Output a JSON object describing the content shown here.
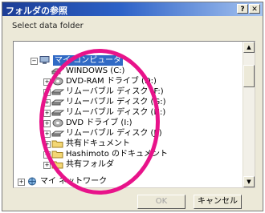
{
  "dialog": {
    "title": "フォルダの参照",
    "help_label": "?",
    "close_label": "✕",
    "prompt": "Select data folder",
    "ok_label": "OK",
    "cancel_label": "キャンセル"
  },
  "tree": {
    "root": {
      "label": "マイ コンピュータ",
      "expander": "−",
      "icon": "computer-icon"
    },
    "items": [
      {
        "label": "WINDOWS (C:)",
        "expander": "",
        "icon": "hard-drive-icon"
      },
      {
        "label": "DVD-RAM ドライブ (D:)",
        "expander": "+",
        "icon": "dvd-drive-icon"
      },
      {
        "label": "リムーバブル ディスク (F:)",
        "expander": "+",
        "icon": "removable-disk-icon"
      },
      {
        "label": "リムーバブル ディスク (G:)",
        "expander": "+",
        "icon": "removable-disk-icon"
      },
      {
        "label": "リムーバブル ディスク (H:)",
        "expander": "+",
        "icon": "removable-disk-icon"
      },
      {
        "label": "DVD ドライブ (I:)",
        "expander": "+",
        "icon": "dvd-drive-icon"
      },
      {
        "label": "リムーバブル ディスク (J:)",
        "expander": "+",
        "icon": "removable-disk-icon"
      },
      {
        "label": "共有ドキュメント",
        "expander": "+",
        "icon": "folder-icon"
      },
      {
        "label": "Hashimoto のドキュメント",
        "expander": "+",
        "icon": "folder-icon"
      },
      {
        "label": "共有フォルダ",
        "expander": "+",
        "icon": "folder-icon"
      }
    ],
    "bottom": {
      "label": "マイ ネットワーク",
      "expander": "+",
      "icon": "network-icon"
    }
  },
  "colors": {
    "highlight_ring": "#e8138a",
    "title_bar": "#2c61c7",
    "selection": "#316ac5"
  }
}
